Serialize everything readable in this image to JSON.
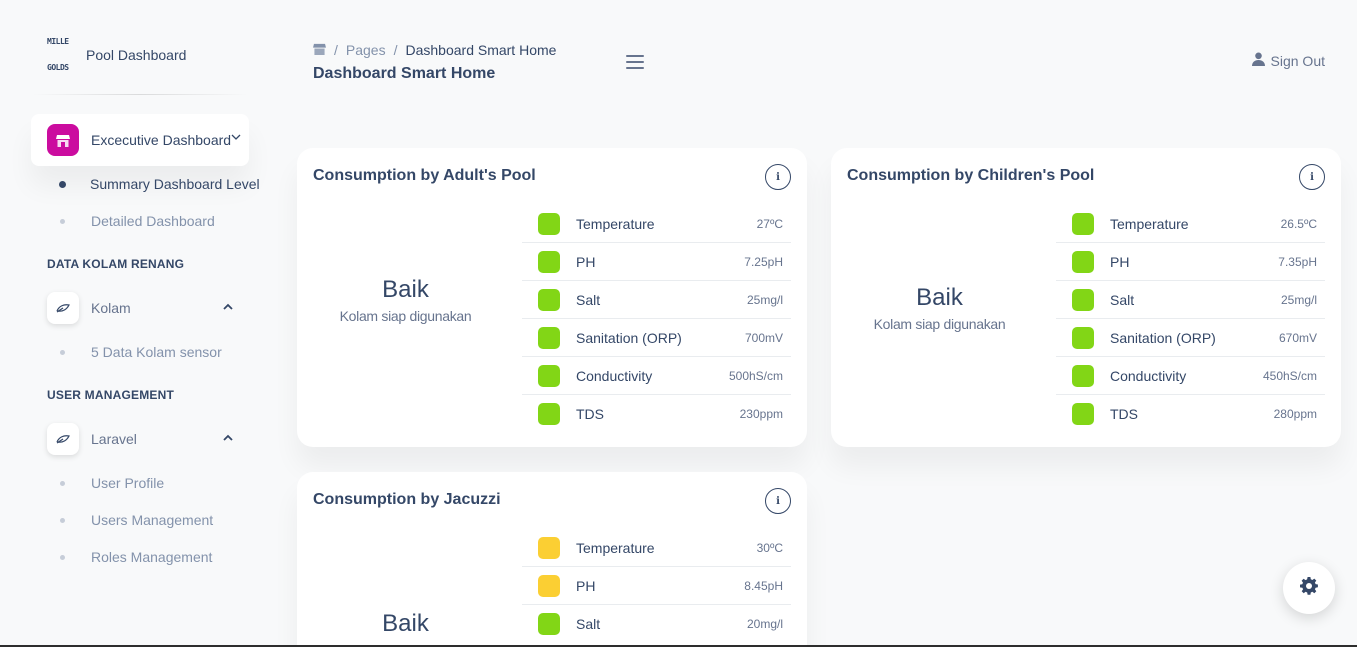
{
  "brand": {
    "logo_lines": [
      "MILLE",
      "GOLDS"
    ],
    "name": "Pool Dashboard"
  },
  "sidebar": {
    "active_item": {
      "label": "Excecutive Dashboard",
      "icon": "shop-icon",
      "chevron": "⌄"
    },
    "active_subitems": [
      {
        "label": "Summary Dashboard Level",
        "active": true
      },
      {
        "label": "Detailed Dashboard",
        "active": false
      }
    ],
    "sections": [
      {
        "title": "DATA KOLAM RENANG",
        "item": {
          "label": "Kolam",
          "icon": "leaf-icon",
          "caret": "⌃"
        },
        "subitems": [
          {
            "label": "5 Data Kolam sensor"
          }
        ]
      },
      {
        "title": "USER MANAGEMENT",
        "item": {
          "label": "Laravel",
          "icon": "leaf-icon",
          "caret": "⌃"
        },
        "subitems": [
          {
            "label": "User Profile"
          },
          {
            "label": "Users Management"
          },
          {
            "label": "Roles Management"
          }
        ]
      }
    ]
  },
  "header": {
    "breadcrumb": {
      "home_icon": "shop-icon",
      "pages": "Pages",
      "current": "Dashboard Smart Home"
    },
    "title": "Dashboard Smart Home",
    "signout": "Sign Out"
  },
  "colors": {
    "green": "#82d616",
    "yellow": "#fbcf33",
    "primary": "#344767",
    "pink": "#cb0c9f"
  },
  "cards": [
    {
      "title": "Consumption by Adult's Pool",
      "status": "Baik",
      "status_note": "Kolam siap digunakan",
      "metrics": [
        {
          "name": "Temperature",
          "value": "27ºC",
          "status": "green"
        },
        {
          "name": "PH",
          "value": "7.25pH",
          "status": "green"
        },
        {
          "name": "Salt",
          "value": "25mg/l",
          "status": "green"
        },
        {
          "name": "Sanitation (ORP)",
          "value": "700mV",
          "status": "green"
        },
        {
          "name": "Conductivity",
          "value": "500hS/cm",
          "status": "green"
        },
        {
          "name": "TDS",
          "value": "230ppm",
          "status": "green"
        }
      ]
    },
    {
      "title": "Consumption by Children's Pool",
      "status": "Baik",
      "status_note": "Kolam siap digunakan",
      "metrics": [
        {
          "name": "Temperature",
          "value": "26.5ºC",
          "status": "green"
        },
        {
          "name": "PH",
          "value": "7.35pH",
          "status": "green"
        },
        {
          "name": "Salt",
          "value": "25mg/l",
          "status": "green"
        },
        {
          "name": "Sanitation (ORP)",
          "value": "670mV",
          "status": "green"
        },
        {
          "name": "Conductivity",
          "value": "450hS/cm",
          "status": "green"
        },
        {
          "name": "TDS",
          "value": "280ppm",
          "status": "green"
        }
      ]
    },
    {
      "title": "Consumption by Jacuzzi",
      "status": "Baik",
      "status_note": "",
      "metrics": [
        {
          "name": "Temperature",
          "value": "30ºC",
          "status": "yellow"
        },
        {
          "name": "PH",
          "value": "8.45pH",
          "status": "yellow"
        },
        {
          "name": "Salt",
          "value": "20mg/l",
          "status": "green"
        }
      ]
    }
  ],
  "info_icon_glyph": "i"
}
